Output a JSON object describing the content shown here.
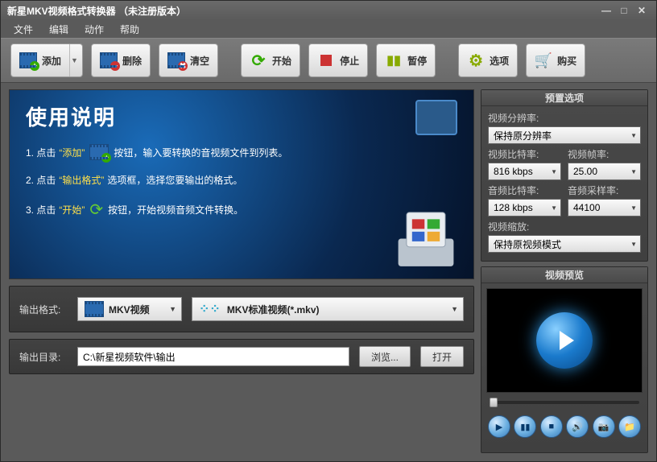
{
  "title": "新星MKV视频格式转换器 （未注册版本）",
  "menu": {
    "file": "文件",
    "edit": "编辑",
    "action": "动作",
    "help": "帮助"
  },
  "toolbar": {
    "add": "添加",
    "delete": "删除",
    "clear": "清空",
    "start": "开始",
    "stop": "停止",
    "pause": "暂停",
    "options": "选项",
    "buy": "购买"
  },
  "guide": {
    "title": "使用说明",
    "s1a": "1. 点击",
    "s1q": "“添加”",
    "s1b": "按钮，输入要转换的音视频文件到列表。",
    "s2a": "2. 点击",
    "s2q": "“输出格式”",
    "s2b": "选项框，选择您要输出的格式。",
    "s3a": "3. 点击",
    "s3q": "“开始”",
    "s3b": "按钮，开始视频音频文件转换。"
  },
  "output": {
    "format_label": "输出格式:",
    "category": "MKV视频",
    "profile": "MKV标准视频(*.mkv)",
    "dir_label": "输出目录:",
    "dir": "C:\\新星视频软件\\输出",
    "browse": "浏览...",
    "open": "打开"
  },
  "preset": {
    "header": "预置选项",
    "vres_label": "视频分辨率:",
    "vres": "保持原分辨率",
    "vbit_label": "视频比特率:",
    "vbit": "816 kbps",
    "vfps_label": "视频帧率:",
    "vfps": "25.00",
    "abit_label": "音频比特率:",
    "abit": "128 kbps",
    "asr_label": "音频采样率:",
    "asr": "44100",
    "vscale_label": "视频缩放:",
    "vscale": "保持原视频模式"
  },
  "preview_header": "视频预览"
}
